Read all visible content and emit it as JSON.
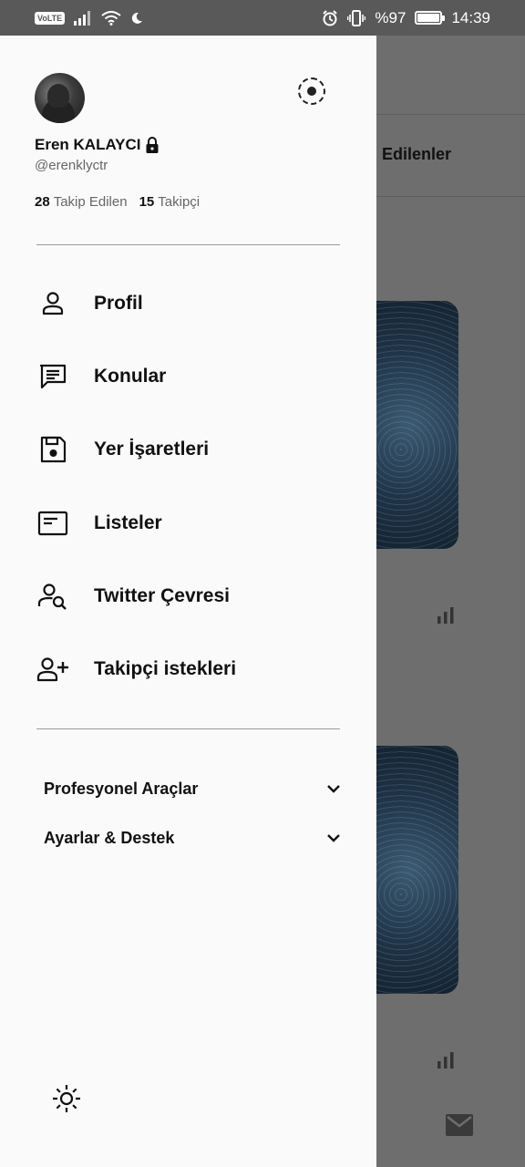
{
  "status_bar": {
    "carrier_badge": "VoLTE",
    "battery_text": "%97",
    "battery_level": 0.97,
    "time": "14:39"
  },
  "background_app": {
    "tab_label": "Edilenler"
  },
  "drawer": {
    "profile": {
      "display_name": "Eren KALAYCI",
      "username": "@erenklyctr",
      "following_count": "28",
      "following_label": "Takip Edilen",
      "followers_count": "15",
      "followers_label": "Takipçi"
    },
    "menu": [
      {
        "label": "Profil",
        "icon": "person-icon"
      },
      {
        "label": "Konular",
        "icon": "topics-icon"
      },
      {
        "label": "Yer İşaretleri",
        "icon": "bookmark-icon"
      },
      {
        "label": "Listeler",
        "icon": "lists-icon"
      },
      {
        "label": "Twitter Çevresi",
        "icon": "twitter-circle-icon"
      },
      {
        "label": "Takipçi istekleri",
        "icon": "follower-requests-icon"
      }
    ],
    "sections": [
      {
        "label": "Profesyonel Araçlar"
      },
      {
        "label": "Ayarlar & Destek"
      }
    ]
  }
}
